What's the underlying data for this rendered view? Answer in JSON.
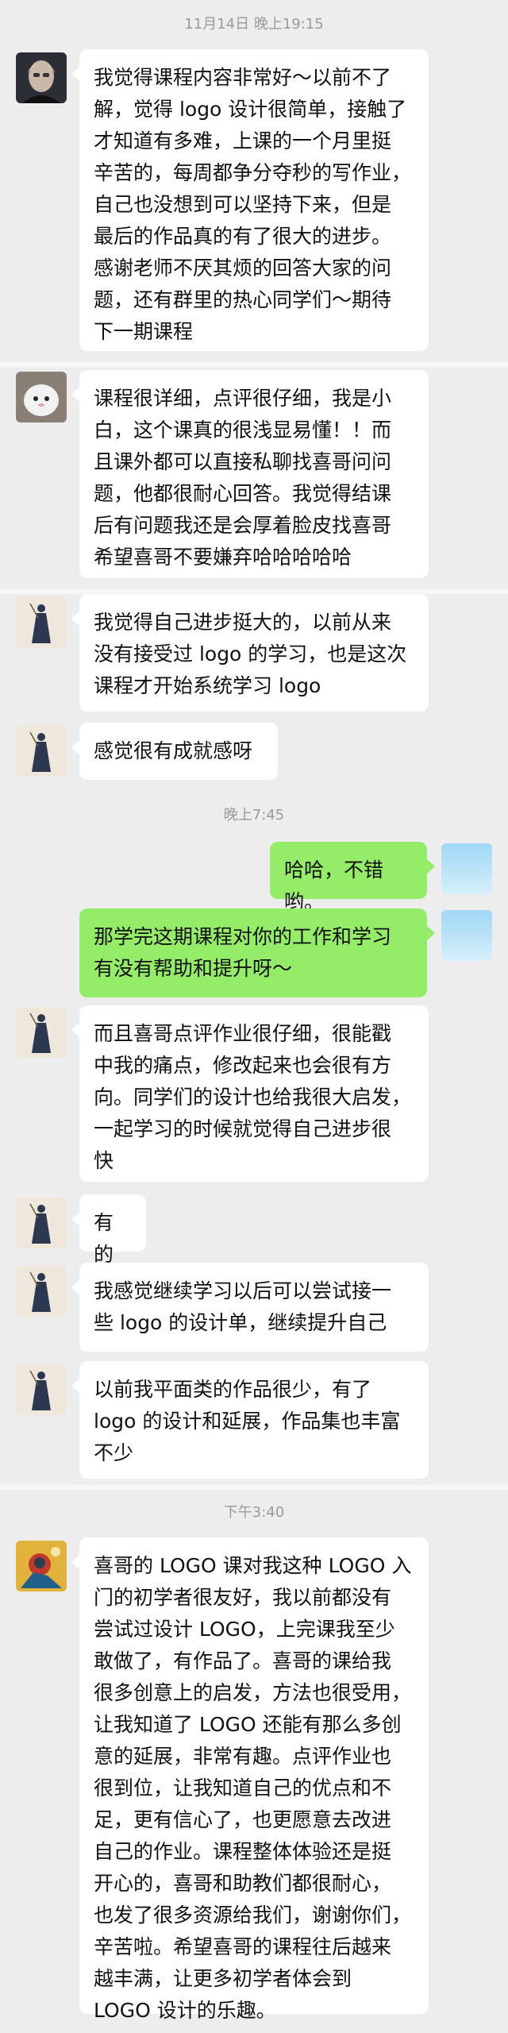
{
  "timestamps": {
    "t1": "11月14日 晚上19:15",
    "t2": "晚上7:45",
    "t3": "下午3:40"
  },
  "messages": {
    "m1": "我觉得课程内容非常好～以前不了\n解，觉得 logo 设计很简单，接触了\n才知道有多难，上课的一个月里挺\n辛苦的，每周都争分夺秒的写作业，\n自己也没想到可以坚持下来，但是\n最后的作品真的有了很大的进步。\n感谢老师不厌其烦的回答大家的问\n题，还有群里的热心同学们～期待\n下一期课程",
    "m2": "课程很详细，点评很仔细，我是小\n白，这个课真的很浅显易懂！！而\n且课外都可以直接私聊找喜哥问问\n题，他都很耐心回答。我觉得结课\n后有问题我还是会厚着脸皮找喜哥\n希望喜哥不要嫌弃哈哈哈哈哈",
    "m3": "我觉得自己进步挺大的，以前从来\n没有接受过 logo 的学习，也是这次\n课程才开始系统学习 logo",
    "m4": "感觉很有成就感呀",
    "m5": "哈哈，不错哟。",
    "m6": "那学完这期课程对你的工作和学习\n有没有帮助和提升呀～",
    "m7": "而且喜哥点评作业很仔细，很能戳\n中我的痛点，修改起来也会很有方\n向。同学们的设计也给我很大启发，\n一起学习的时候就觉得自己进步很\n快",
    "m8": "有的",
    "m9": "我感觉继续学习以后可以尝试接一\n些 logo 的设计单，继续提升自己",
    "m10": "以前我平面类的作品很少，有了\nlogo 的设计和延展，作品集也丰富\n不少",
    "m11": "喜哥的 LOGO 课对我这种 LOGO 入\n门的初学者很友好，我以前都没有\n尝试过设计 LOGO，上完课我至少\n敢做了，有作品了。喜哥的课给我\n很多创意上的启发，方法也很受用，\n让我知道了 LOGO 还能有那么多创\n意的延展，非常有趣。点评作业也\n很到位，让我知道自己的优点和不\n足，更有信心了，也更愿意去改进\n自己的作业。课程整体体验还是挺\n开心的，喜哥和助教们都很耐心，\n也发了很多资源给我们，谢谢你们，\n辛苦啦。希望喜哥的课程往后越来\n越丰满，让更多初学者体会到\nLOGO 设计的乐趣。"
  },
  "colors": {
    "background": "#ededed",
    "sent_bubble": "#95ec69",
    "received_bubble": "#ffffff",
    "timestamp_text": "#9a9a9a"
  }
}
